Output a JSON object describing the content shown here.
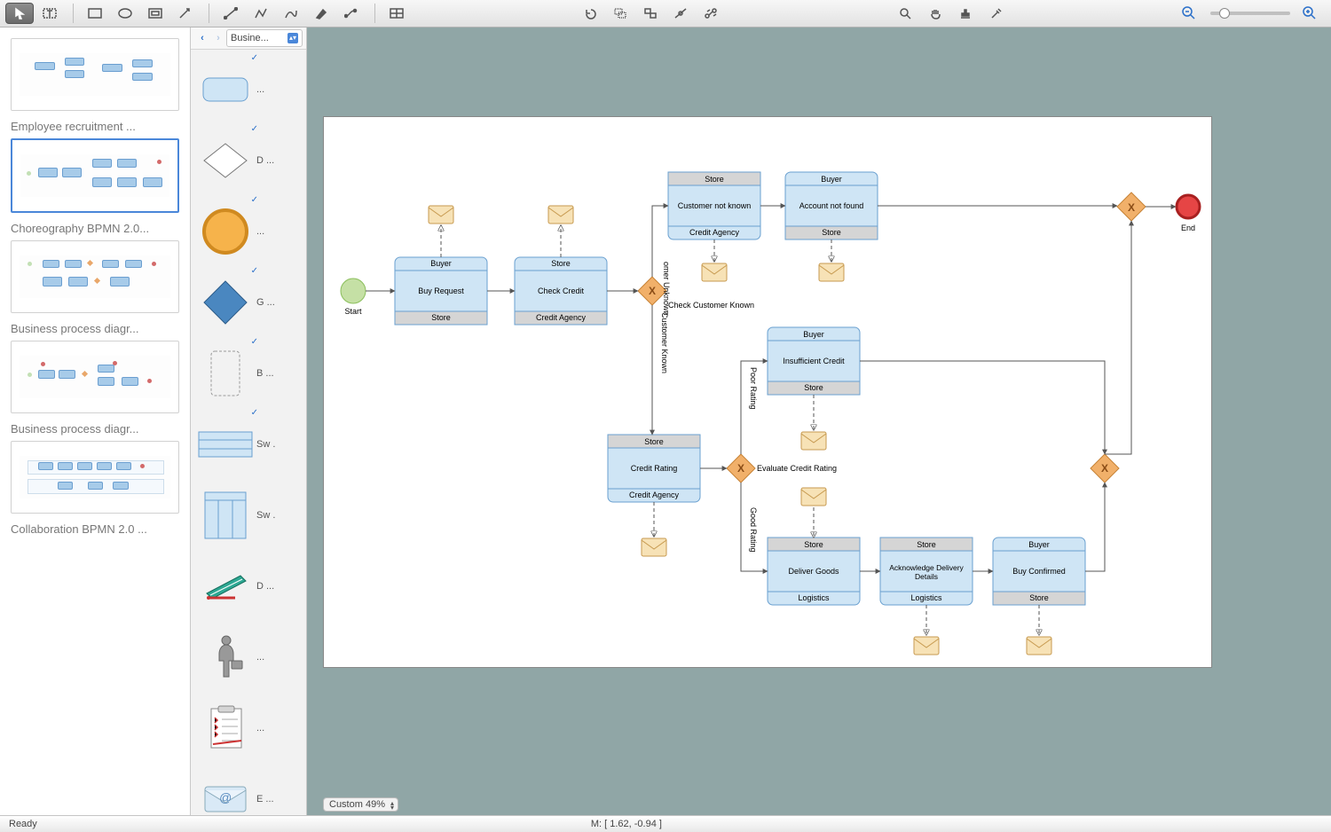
{
  "toolbar": {
    "arrow": "arrow",
    "text": "text",
    "rect": "rect",
    "ellipse": "ellipse",
    "boxed": "boxed",
    "pointer": "pointer",
    "line": "line",
    "poly": "polyline",
    "curve": "curve",
    "pen": "pen",
    "connect": "connector",
    "table": "table",
    "rotate": "rotate",
    "align": "align",
    "flip": "flip",
    "arrange": "arrange",
    "redo": "redo",
    "search": "search",
    "hand": "hand",
    "stamp": "stamp",
    "eyedrop": "eyedropper",
    "zoomout": "zoom-out",
    "zoomin": "zoom-in"
  },
  "pages": [
    {
      "label": "Employee recruitment ..."
    },
    {
      "label": "Choreography BPMN 2.0..."
    },
    {
      "label": "Business process diagr..."
    },
    {
      "label": "Business process diagr..."
    },
    {
      "label": "Collaboration BPMN 2.0 ..."
    }
  ],
  "shapesPanel": {
    "dropdown": "Busine...",
    "items": [
      {
        "label": "..."
      },
      {
        "label": "D ..."
      },
      {
        "label": "..."
      },
      {
        "label": "G ..."
      },
      {
        "label": "B ..."
      },
      {
        "label": "Sw ."
      },
      {
        "label": "Sw ."
      },
      {
        "label": "D ..."
      },
      {
        "label": "..."
      },
      {
        "label": "..."
      },
      {
        "label": "E ..."
      }
    ]
  },
  "diagram": {
    "start": "Start",
    "end": "End",
    "tasks": {
      "buyRequest": {
        "top": "Buyer",
        "mid": "Buy Request",
        "bot": "Store"
      },
      "checkCredit": {
        "top": "Store",
        "mid": "Check Credit",
        "bot": "Credit Agency"
      },
      "custNotKnown": {
        "top": "Store",
        "mid": "Customer not known",
        "bot": "Credit Agency"
      },
      "acctNotFound": {
        "top": "Buyer",
        "mid": "Account not found",
        "bot": "Store"
      },
      "creditRating": {
        "top": "Store",
        "mid": "Credit Rating",
        "bot": "Credit Agency"
      },
      "insuffCredit": {
        "top": "Buyer",
        "mid": "Insufficient Credit",
        "bot": "Store"
      },
      "deliverGoods": {
        "top": "Store",
        "mid": "Deliver Goods",
        "bot": "Logistics"
      },
      "ackDelivery": {
        "top": "Store",
        "mid": "Acknowledge Delivery Details",
        "bot": "Logistics"
      },
      "buyConfirmed": {
        "top": "Buyer",
        "mid": "Buy Confirmed",
        "bot": "Store"
      }
    },
    "gateways": {
      "g1": "Check Customer Known",
      "g2": "Evaluate Credit Rating"
    },
    "labels": {
      "custUnknown": "   omer Unknown",
      "custKnown": "Customer Known",
      "poor": "Poor Rating",
      "good": "Good Rating"
    }
  },
  "zoom": "Custom 49%",
  "status": {
    "ready": "Ready",
    "coords": "M: [ 1.62, -0.94 ]"
  }
}
